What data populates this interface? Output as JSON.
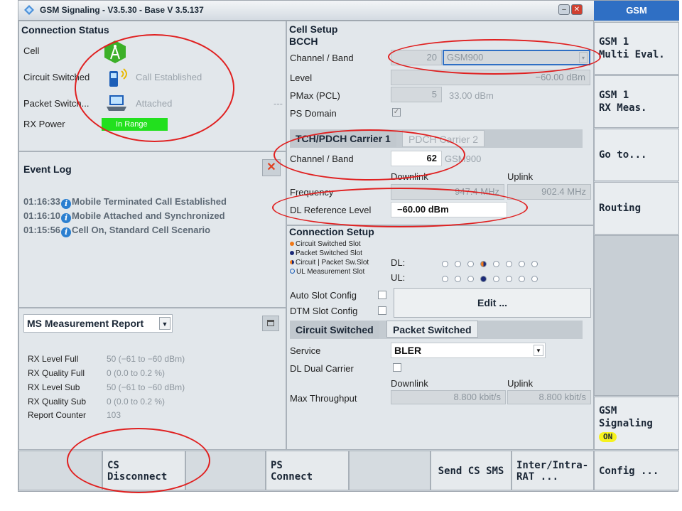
{
  "window": {
    "title": "GSM Signaling  - V3.5.30 - Base V 3.5.137"
  },
  "connection_status": {
    "header": "Connection Status",
    "cell_label": "Cell",
    "cs_label": "Circuit Switched",
    "cs_value": "Call Established",
    "ps_label": "Packet Switch...",
    "ps_value": "Attached",
    "rx_label": "RX Power",
    "rx_value": "In Range",
    "more": "---"
  },
  "event_log": {
    "header": "Event Log",
    "entries": [
      {
        "time": "01:16:33",
        "text": "Mobile Terminated Call Established"
      },
      {
        "time": "01:16:10",
        "text": "Mobile Attached and Synchronized"
      },
      {
        "time": "01:15:56",
        "text": "Cell On, Standard Cell Scenario"
      }
    ]
  },
  "ms_report": {
    "dropdown": "MS Measurement Report",
    "rows": [
      {
        "label": "RX Level Full",
        "value": "50 (−61 to −60 dBm)"
      },
      {
        "label": "RX Quality Full",
        "value": "0 (0.0 to 0.2 %)"
      },
      {
        "label": "RX Level Sub",
        "value": "50 (−61 to −60 dBm)"
      },
      {
        "label": "RX Quality Sub",
        "value": "0 (0.0 to 0.2 %)"
      },
      {
        "label": "Report Counter",
        "value": "103"
      }
    ]
  },
  "cell_setup": {
    "header": "Cell Setup",
    "bcch": "BCCH",
    "channel_band_label": "Channel / Band",
    "bcch_channel": "20",
    "bcch_band": "GSM900",
    "level_label": "Level",
    "level_value": "−60.00  dBm",
    "pmax_label": "PMax (PCL)",
    "pmax_pcl": "5",
    "pmax_value": "33.00  dBm",
    "ps_domain_label": "PS Domain",
    "tab1": "TCH/PDCH Carrier 1",
    "tab2": "PDCH Carrier 2",
    "tch_channel_label": "Channel / Band",
    "tch_channel": "62",
    "tch_band": "GSM900",
    "downlink": "Downlink",
    "uplink": "Uplink",
    "frequency_label": "Frequency",
    "freq_dl": "947.4  MHz",
    "freq_ul": "902.4  MHz",
    "dl_ref_label": "DL Reference Level",
    "dl_ref_value": "−60.00  dBm"
  },
  "connection_setup": {
    "header": "Connection Setup",
    "legend": [
      "Circuit Switched Slot",
      "Packet Switched Slot",
      "Circuit | Packet Sw.Slot",
      "UL Measurement Slot"
    ],
    "dl_label": "DL:",
    "ul_label": "UL:",
    "auto_slot": "Auto Slot Config",
    "dtm_slot": "DTM Slot Config",
    "edit_button": "Edit ...",
    "tab_cs": "Circuit Switched",
    "tab_ps": "Packet Switched",
    "service_label": "Service",
    "service_value": "BLER",
    "dl_dual_carrier": "DL Dual Carrier",
    "downlink": "Downlink",
    "uplink": "Uplink",
    "max_tp_label": "Max Throughput",
    "max_tp_dl": "8.800  kbit/s",
    "max_tp_ul": "8.800  kbit/s"
  },
  "sidebar": {
    "top_label": "GSM",
    "items": [
      {
        "label": "GSM 1\nMulti Eval."
      },
      {
        "label": "GSM 1\nRX Meas."
      },
      {
        "label": "Go to..."
      },
      {
        "label": "Routing"
      }
    ],
    "signaling_label": "GSM\nSignaling",
    "signaling_state": "ON"
  },
  "bottom_bar": {
    "cs_disconnect": "CS\nDisconnect",
    "ps_connect": "PS\nConnect",
    "send_sms": "Send CS SMS",
    "inter_rat": "Inter/Intra-\nRAT ...",
    "config": "Config ..."
  },
  "colors": {
    "accent_blue": "#2f6fc4",
    "rx_green": "#22e01e",
    "annotation_red": "#e02020",
    "on_yellow": "#f6f21e"
  }
}
